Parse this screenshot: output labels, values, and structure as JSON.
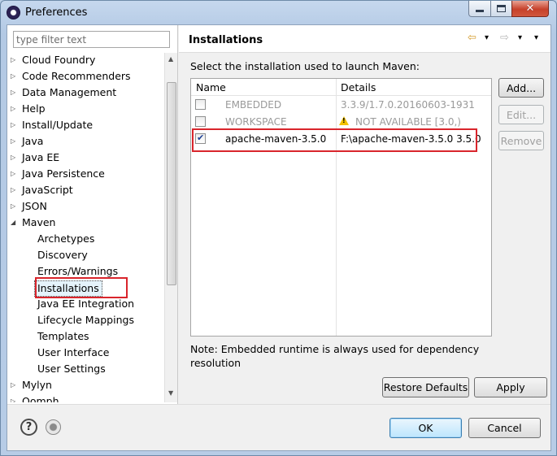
{
  "window": {
    "title": "Preferences",
    "close_glyph": "✕"
  },
  "filter": {
    "placeholder": "type filter text"
  },
  "tree": {
    "items": [
      {
        "label": "Cloud Foundry",
        "level": 0,
        "twisty": "▷"
      },
      {
        "label": "Code Recommenders",
        "level": 0,
        "twisty": "▷"
      },
      {
        "label": "Data Management",
        "level": 0,
        "twisty": "▷"
      },
      {
        "label": "Help",
        "level": 0,
        "twisty": "▷"
      },
      {
        "label": "Install/Update",
        "level": 0,
        "twisty": "▷"
      },
      {
        "label": "Java",
        "level": 0,
        "twisty": "▷"
      },
      {
        "label": "Java EE",
        "level": 0,
        "twisty": "▷"
      },
      {
        "label": "Java Persistence",
        "level": 0,
        "twisty": "▷"
      },
      {
        "label": "JavaScript",
        "level": 0,
        "twisty": "▷"
      },
      {
        "label": "JSON",
        "level": 0,
        "twisty": "▷"
      },
      {
        "label": "Maven",
        "level": 0,
        "twisty": "◢"
      },
      {
        "label": "Archetypes",
        "level": 1
      },
      {
        "label": "Discovery",
        "level": 1
      },
      {
        "label": "Errors/Warnings",
        "level": 1
      },
      {
        "label": "Installations",
        "level": 1,
        "selected": true
      },
      {
        "label": "Java EE Integration",
        "level": 1
      },
      {
        "label": "Lifecycle Mappings",
        "level": 1
      },
      {
        "label": "Templates",
        "level": 1
      },
      {
        "label": "User Interface",
        "level": 1
      },
      {
        "label": "User Settings",
        "level": 1
      },
      {
        "label": "Mylyn",
        "level": 0,
        "twisty": "▷"
      },
      {
        "label": "Oomph",
        "level": 0,
        "twisty": "▷"
      }
    ],
    "scroll_up": "▲",
    "scroll_down": "▼"
  },
  "page": {
    "title": "Installations",
    "nav_back": "⇦",
    "nav_forward": "⇨",
    "nav_menu": "▾",
    "description": "Select the installation used to launch Maven:",
    "columns": {
      "name": "Name",
      "details": "Details"
    },
    "rows": [
      {
        "name": "EMBEDDED",
        "details": "3.3.9/1.7.0.20160603-1931",
        "checked": false,
        "enabled": false
      },
      {
        "name": "WORKSPACE",
        "details": "NOT AVAILABLE [3.0,)",
        "checked": false,
        "enabled": false,
        "warning": true
      },
      {
        "name": "apache-maven-3.5.0",
        "details": "F:\\apache-maven-3.5.0 3.5.0",
        "checked": true,
        "enabled": true
      }
    ],
    "buttons": {
      "add": "Add...",
      "edit": "Edit...",
      "remove": "Remove",
      "restore_defaults": "Restore Defaults",
      "apply": "Apply"
    },
    "note": "Note: Embedded runtime is always used for dependency resolution"
  },
  "footer": {
    "ok": "OK",
    "cancel": "Cancel",
    "help_glyph": "?"
  },
  "colors": {
    "highlight": "#d9252c",
    "selection": "#e5f3fb",
    "warning": "#f2c100"
  }
}
